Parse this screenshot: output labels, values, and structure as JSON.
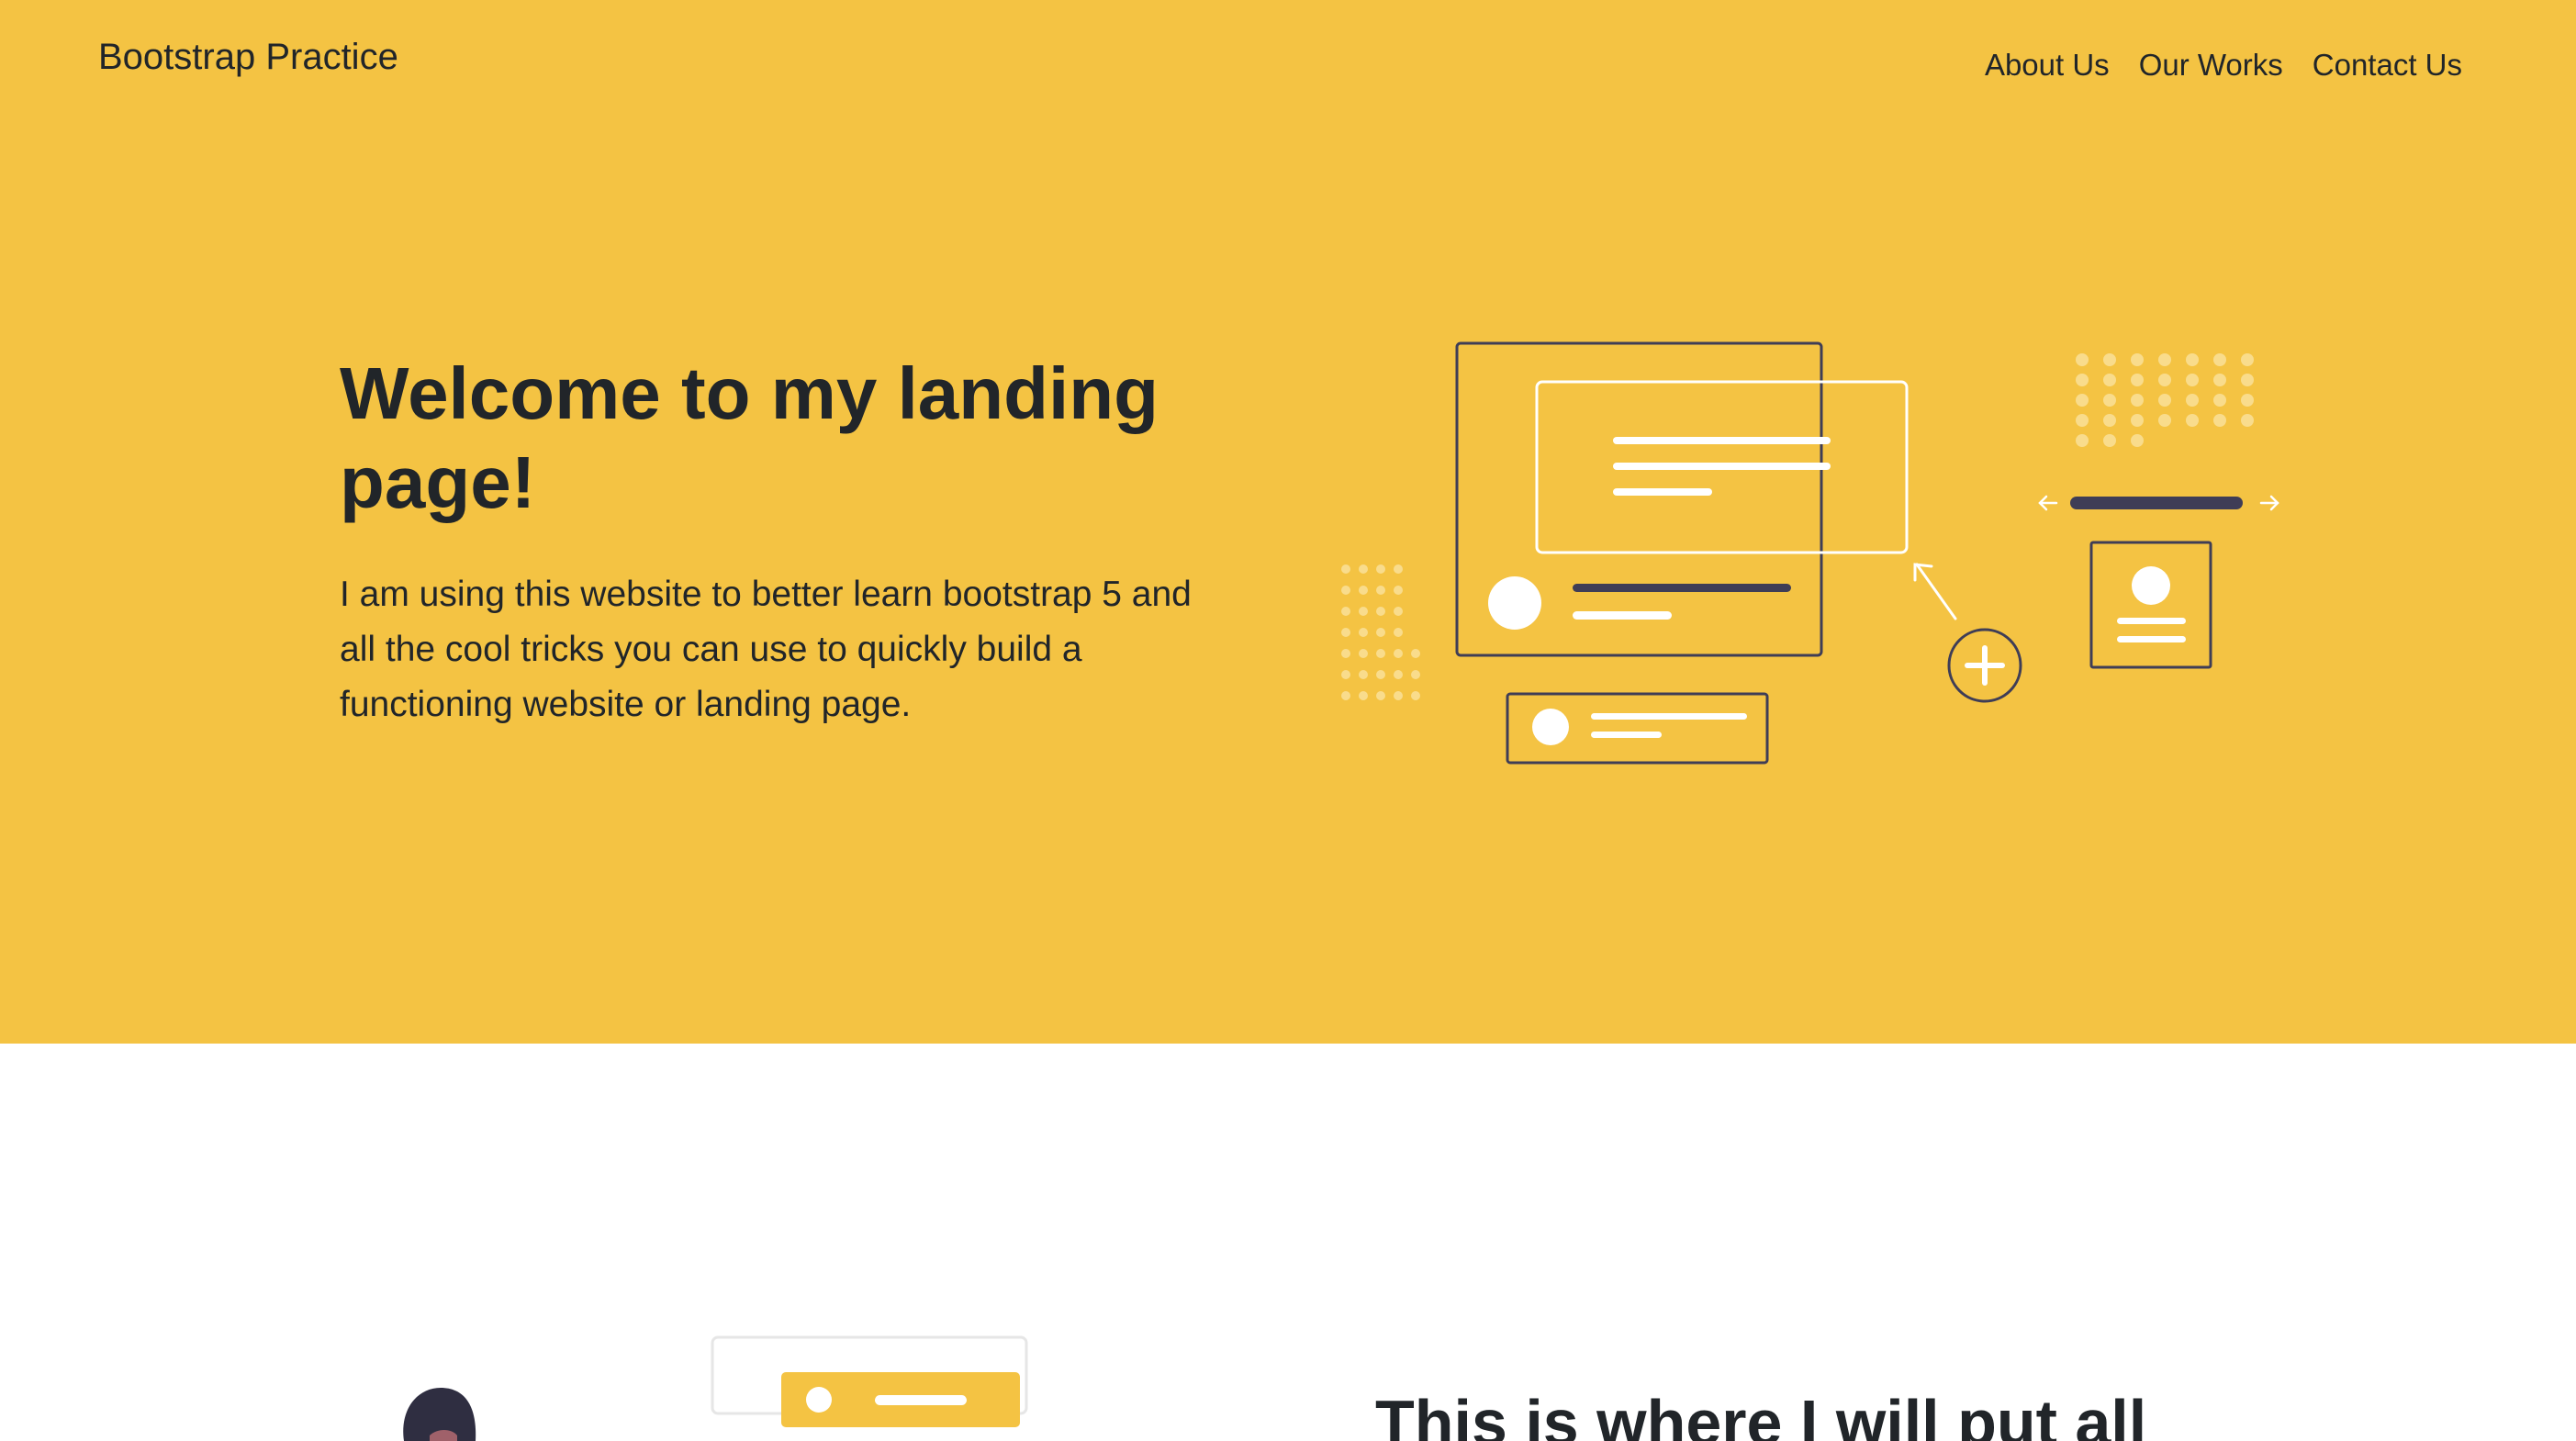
{
  "navbar": {
    "brand": "Bootstrap Practice",
    "links": [
      "About Us",
      "Our Works",
      "Contact Us"
    ]
  },
  "hero": {
    "title": "Welcome to my landing page!",
    "text": "I am using this website to better learn bootstrap 5 and all the cool tricks you can use to quickly build a functioning website or landing page.",
    "illustration": "landing-page-wireframe-illustration"
  },
  "section2": {
    "heading": "This is where I will put all",
    "illustration": "person-with-card-illustration"
  },
  "colors": {
    "accent": "#f4c343",
    "text": "#212529",
    "dark_line": "#3f3d56",
    "background": "#ffffff"
  }
}
